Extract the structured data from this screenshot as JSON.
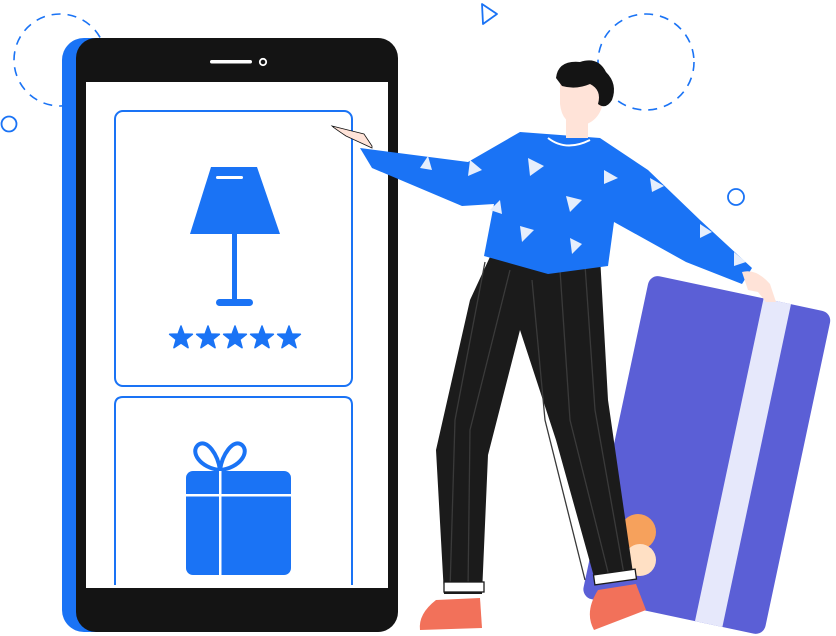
{
  "colors": {
    "brand_blue": "#1a73f5",
    "phone_body": "#141414",
    "phone_shadow": "#1a73f5",
    "screen_bg": "#ffffff",
    "card_border": "#1a73f5",
    "card_purple": "#5b5fd6",
    "card_stripe": "#e6e8fb",
    "coin_orange": "#f6a15c",
    "shoe": "#f2715a",
    "pants": "#1b1b1b",
    "skin": "#ffe3d8",
    "hair": "#141414",
    "decor_line": "#1a73f5"
  },
  "product_cards": [
    {
      "icon": "lamp-icon",
      "rating": 5
    },
    {
      "icon": "gift-icon"
    }
  ],
  "icons": {
    "camera": "camera-dot-icon",
    "speaker": "speaker-slot-icon",
    "star": "star-icon",
    "credit_card": "credit-card-icon",
    "coin": "coin-icon"
  }
}
